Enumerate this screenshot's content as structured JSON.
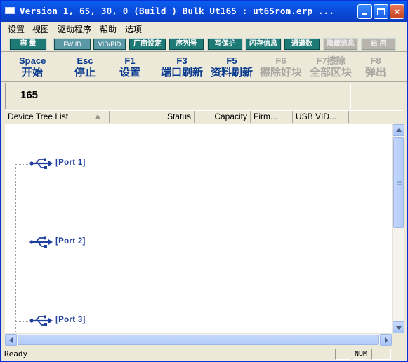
{
  "window": {
    "title": "Version 1, 65, 30, 0 (Build )  Bulk Ut165 : ut65rom.erp ...",
    "minimize_label": "_",
    "close_label": "×"
  },
  "menu": {
    "items": [
      {
        "label": "设置"
      },
      {
        "label": "视图"
      },
      {
        "label": "驱动程序"
      },
      {
        "label": "帮助"
      },
      {
        "label": "选项"
      }
    ]
  },
  "toolbar1": {
    "buttons": [
      {
        "label": "容  量",
        "enabled": true
      },
      {
        "label": "FW ID",
        "enabled": true
      },
      {
        "label": "VID/PID",
        "enabled": true
      },
      {
        "label": "厂商设定",
        "enabled": true
      },
      {
        "label": "序列号",
        "enabled": true
      },
      {
        "label": "写保护",
        "enabled": true
      },
      {
        "label": "闪存信息",
        "enabled": true
      },
      {
        "label": "通道数",
        "enabled": true
      },
      {
        "label": "隐藏信息",
        "enabled": false
      },
      {
        "label": "启  用",
        "enabled": false
      }
    ]
  },
  "toolbar2": {
    "keys": [
      {
        "key": "Space",
        "label": "开始",
        "enabled": true
      },
      {
        "key": "Esc",
        "label": "停止",
        "enabled": true
      },
      {
        "key": "F1",
        "label": "设置",
        "enabled": true
      },
      {
        "key": "F3",
        "label": "端口刷新",
        "enabled": true
      },
      {
        "key": "F5",
        "label": "资料刷新",
        "enabled": true
      },
      {
        "key": "F6",
        "label": "擦除好块",
        "enabled": false
      },
      {
        "key": "F7擦除",
        "label": "全部区块",
        "enabled": false
      },
      {
        "key": "F8",
        "label": "弹出",
        "enabled": false
      }
    ]
  },
  "infobar": {
    "value": "165"
  },
  "list": {
    "columns": [
      {
        "label": "Device Tree List"
      },
      {
        "label": "Status"
      },
      {
        "label": "Capacity"
      },
      {
        "label": "Firm..."
      },
      {
        "label": "USB VID..."
      }
    ],
    "ports": [
      {
        "label": "[Port  1]"
      },
      {
        "label": "[Port  2]"
      },
      {
        "label": "[Port  3]"
      }
    ]
  },
  "statusbar": {
    "text": "Ready",
    "num": "NUM"
  },
  "colors": {
    "titlebar": "#0b4ee0",
    "button_teal": "#1e7a75",
    "fkey_text": "#0b3b8f",
    "port_text": "#1f3f9e",
    "usb_icon": "#1f3f9e"
  }
}
